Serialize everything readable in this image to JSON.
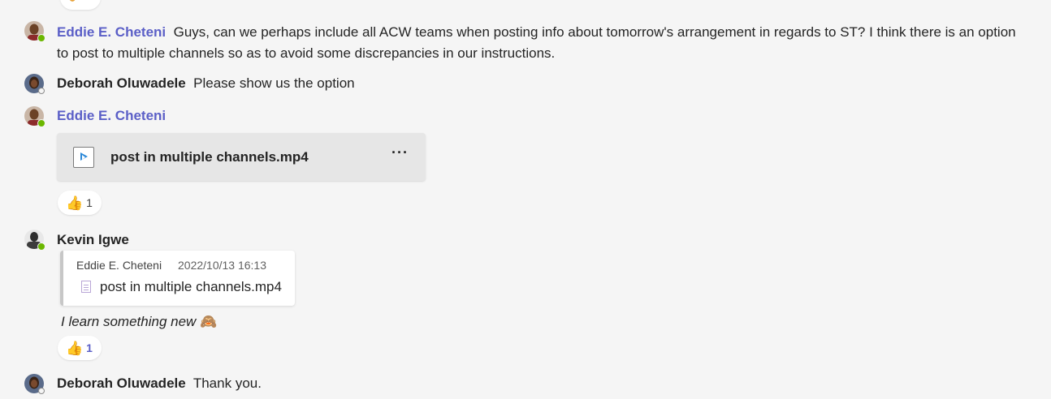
{
  "colors": {
    "background": "#f5f5f5",
    "self_name": "#5b5fc7",
    "presence_available": "#6bb700",
    "file_card": "#e6e6e6"
  },
  "messages": [
    {
      "author": "Eddie E. Cheteni",
      "is_self": true,
      "presence": "available",
      "text_line1": "Guys, can we perhaps include all ACW teams when posting info about tomorrow's arrangement in regards to ST? I think there is an option",
      "text_line2": "to post to multiple channels so as to avoid some discrepancies in our instructions."
    },
    {
      "author": "Deborah Oluwadele",
      "presence": "offline",
      "text": "Please show us the option"
    },
    {
      "author": "Eddie E. Cheteni",
      "is_self": true,
      "presence": "available",
      "attachment": {
        "icon": "video-file-icon",
        "file_name": "post in multiple channels.mp4",
        "more_label": "···"
      },
      "reaction": {
        "emoji": "👍",
        "count": "1"
      }
    },
    {
      "author": "Kevin Igwe",
      "presence": "available",
      "quote": {
        "author": "Eddie E. Cheteni",
        "timestamp": "2022/10/13 16:13",
        "file_name": "post in multiple channels.mp4"
      },
      "text": "I learn something new",
      "emoji": "🙈",
      "reaction": {
        "emoji": "👍",
        "count": "1"
      }
    },
    {
      "author": "Deborah Oluwadele",
      "presence": "offline",
      "text": "Thank you."
    }
  ]
}
